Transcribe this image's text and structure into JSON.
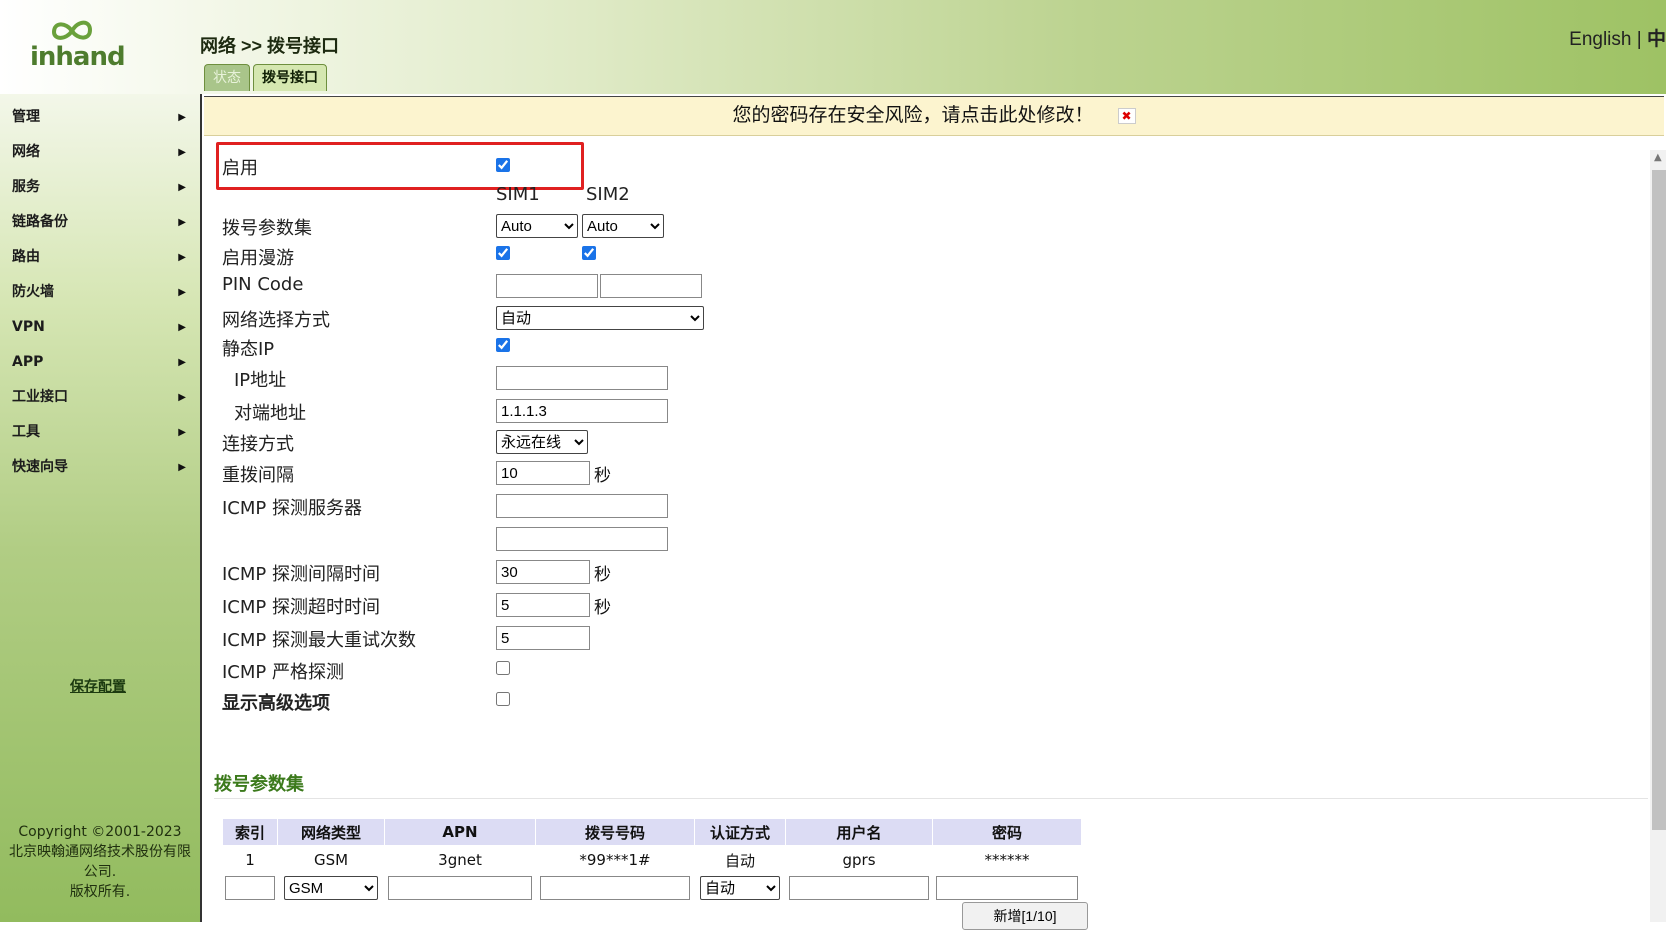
{
  "logo": {
    "text": "inhand"
  },
  "breadcrumb": "网络 >> 拨号接口",
  "lang": {
    "english": "English",
    "sep": "|",
    "chinese": "中"
  },
  "tabs": [
    {
      "label": "状态"
    },
    {
      "label": "拨号接口"
    }
  ],
  "nav": [
    {
      "label": "管理"
    },
    {
      "label": "网络"
    },
    {
      "label": "服务"
    },
    {
      "label": "链路备份"
    },
    {
      "label": "路由"
    },
    {
      "label": "防火墙"
    },
    {
      "label": "VPN"
    },
    {
      "label": "APP"
    },
    {
      "label": "工业接口"
    },
    {
      "label": "工具"
    },
    {
      "label": "快速向导"
    }
  ],
  "save_config": "保存配置",
  "copyright": {
    "line1": "Copyright ©2001-2023",
    "line2": "北京映翰通网络技术股份有限",
    "line3": "公司.",
    "line4": "版权所有."
  },
  "warning": {
    "text": "您的密码存在安全风险，请点击此处修改！",
    "close": "✖"
  },
  "form": {
    "enable": {
      "label": "启用",
      "checked": true
    },
    "sim1": "SIM1",
    "sim2": "SIM2",
    "dial_profile": {
      "label": "拨号参数集",
      "sim1_value": "Auto",
      "sim2_value": "Auto"
    },
    "roaming": {
      "label": "启用漫游",
      "sim1": true,
      "sim2": true
    },
    "pin_code": {
      "label": "PIN Code",
      "sim1": "",
      "sim2": ""
    },
    "network_select": {
      "label": "网络选择方式",
      "value": "自动"
    },
    "static_ip": {
      "label": "静态IP",
      "checked": true
    },
    "ip_address": {
      "label": "IP地址",
      "value": ""
    },
    "peer_address": {
      "label": "对端地址",
      "value": "1.1.1.3"
    },
    "connect_mode": {
      "label": "连接方式",
      "value": "永远在线"
    },
    "redial_interval": {
      "label": "重拨间隔",
      "value": "10",
      "unit": "秒"
    },
    "icmp_server": {
      "label": "ICMP 探测服务器",
      "value1": "",
      "value2": ""
    },
    "icmp_interval": {
      "label": "ICMP 探测间隔时间",
      "value": "30",
      "unit": "秒"
    },
    "icmp_timeout": {
      "label": "ICMP 探测超时时间",
      "value": "5",
      "unit": "秒"
    },
    "icmp_retries": {
      "label": "ICMP 探测最大重试次数",
      "value": "5"
    },
    "icmp_strict": {
      "label": "ICMP 严格探测",
      "checked": false
    },
    "advanced": {
      "label": "显示高级选项",
      "checked": false
    }
  },
  "profiles": {
    "title": "拨号参数集",
    "headers": [
      "索引",
      "网络类型",
      "APN",
      "拨号号码",
      "认证方式",
      "用户名",
      "密码"
    ],
    "rows": [
      [
        "1",
        "GSM",
        "3gnet",
        "*99***1#",
        "自动",
        "gprs",
        "******"
      ]
    ],
    "new_row": {
      "network_type": "GSM",
      "auth": "自动"
    },
    "add_button": "新增[1/10]"
  }
}
